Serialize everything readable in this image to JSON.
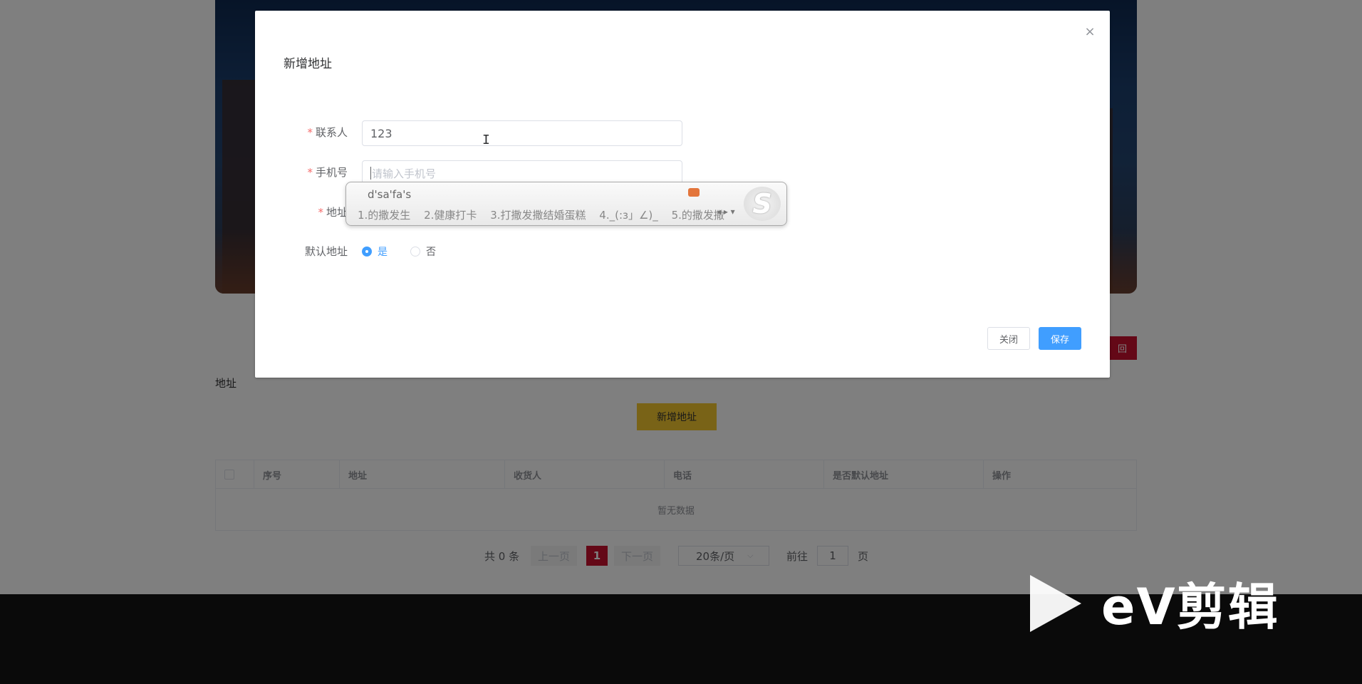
{
  "page": {
    "back_label": "回",
    "section_title": "地址",
    "add_button": "新增地址",
    "table": {
      "headers": [
        "序号",
        "地址",
        "收货人",
        "电话",
        "是否默认地址",
        "操作"
      ],
      "empty_text": "暂无数据"
    },
    "pagination": {
      "total": "共 0 条",
      "prev": "上一页",
      "current": "1",
      "next": "下一页",
      "page_size": "20条/页",
      "goto_prefix": "前往",
      "goto_value": "1",
      "goto_suffix": "页"
    }
  },
  "dialog": {
    "title": "新增地址",
    "close_symbol": "×",
    "fields": {
      "contact": {
        "label": "联系人",
        "value": "123"
      },
      "phone": {
        "label": "手机号",
        "placeholder": "请输入手机号"
      },
      "address": {
        "label": "地址"
      }
    },
    "default_address": {
      "label": "默认地址",
      "yes": "是",
      "no": "否",
      "selected": "是"
    },
    "buttons": {
      "close": "关闭",
      "save": "保存"
    }
  },
  "ime": {
    "pinyin": "d'sa'fa's",
    "candidates": [
      "1.的撒发生",
      "2.健康打卡",
      "3.打撒发撒结婚蛋糕",
      "4._(:з」∠)_",
      "5.的撒发撒"
    ],
    "logo": "S"
  },
  "watermark": {
    "text": "eV剪辑"
  },
  "colors": {
    "primary": "#409eff",
    "brand_red": "#c8102e",
    "add_button": "#f2c62f",
    "required": "#f56c6c"
  }
}
